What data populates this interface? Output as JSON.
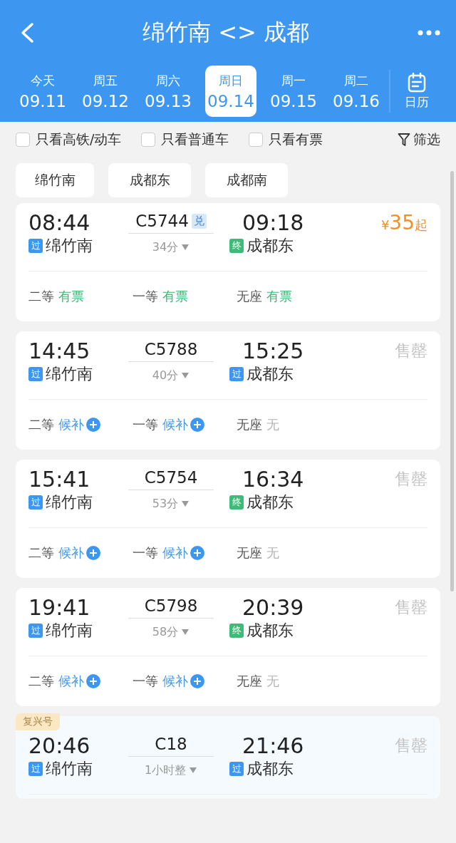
{
  "header": {
    "title": "绵竹南 <> 成都"
  },
  "dates": [
    {
      "weekday": "今天",
      "date": "09.11",
      "selected": false
    },
    {
      "weekday": "周五",
      "date": "09.12",
      "selected": false
    },
    {
      "weekday": "周六",
      "date": "09.13",
      "selected": false
    },
    {
      "weekday": "周日",
      "date": "09.14",
      "selected": true
    },
    {
      "weekday": "周一",
      "date": "09.15",
      "selected": false
    },
    {
      "weekday": "周二",
      "date": "09.16",
      "selected": false
    }
  ],
  "calendar": {
    "label": "日历"
  },
  "filters": [
    {
      "label": "只看高铁/动车",
      "checked": false
    },
    {
      "label": "只看普通车",
      "checked": false
    },
    {
      "label": "只看有票",
      "checked": false
    }
  ],
  "filter_button": {
    "label": "筛选"
  },
  "stations": [
    {
      "label": "绵竹南"
    },
    {
      "label": "成都东"
    },
    {
      "label": "成都南"
    }
  ],
  "trains": [
    {
      "depart": "08:44",
      "train": "C5744",
      "badge": "兑",
      "arrive": "09:18",
      "from_tag": {
        "kind": "pass",
        "text": "过"
      },
      "from": "绵竹南",
      "duration": "34分",
      "to_tag": {
        "kind": "terminal",
        "text": "终"
      },
      "to": "成都东",
      "price": {
        "currency": "¥",
        "amount": "35",
        "suffix": "起"
      },
      "seats": [
        {
          "name": "二等",
          "kind": "available",
          "status": "有票"
        },
        {
          "name": "一等",
          "kind": "available",
          "status": "有票"
        },
        {
          "name": "无座",
          "kind": "available",
          "status": "有票"
        }
      ]
    },
    {
      "depart": "14:45",
      "train": "C5788",
      "arrive": "15:25",
      "from_tag": {
        "kind": "pass",
        "text": "过"
      },
      "from": "绵竹南",
      "duration": "40分",
      "to_tag": {
        "kind": "pass",
        "text": "过"
      },
      "to": "成都东",
      "sold_out": "售罄",
      "seats": [
        {
          "name": "二等",
          "kind": "waitlist",
          "status": "候补"
        },
        {
          "name": "一等",
          "kind": "waitlist",
          "status": "候补"
        },
        {
          "name": "无座",
          "kind": "none",
          "status": "无"
        }
      ]
    },
    {
      "depart": "15:41",
      "train": "C5754",
      "arrive": "16:34",
      "from_tag": {
        "kind": "pass",
        "text": "过"
      },
      "from": "绵竹南",
      "duration": "53分",
      "to_tag": {
        "kind": "terminal",
        "text": "终"
      },
      "to": "成都东",
      "sold_out": "售罄",
      "seats": [
        {
          "name": "二等",
          "kind": "waitlist",
          "status": "候补"
        },
        {
          "name": "一等",
          "kind": "waitlist",
          "status": "候补"
        },
        {
          "name": "无座",
          "kind": "none",
          "status": "无"
        }
      ]
    },
    {
      "depart": "19:41",
      "train": "C5798",
      "arrive": "20:39",
      "from_tag": {
        "kind": "pass",
        "text": "过"
      },
      "from": "绵竹南",
      "duration": "58分",
      "to_tag": {
        "kind": "terminal",
        "text": "终"
      },
      "to": "成都东",
      "sold_out": "售罄",
      "seats": [
        {
          "name": "二等",
          "kind": "waitlist",
          "status": "候补"
        },
        {
          "name": "一等",
          "kind": "waitlist",
          "status": "候补"
        },
        {
          "name": "无座",
          "kind": "none",
          "status": "无"
        }
      ]
    },
    {
      "label": "复兴号",
      "depart": "20:46",
      "train": "C18",
      "arrive": "21:46",
      "from_tag": {
        "kind": "pass",
        "text": "过"
      },
      "from": "绵竹南",
      "duration": "1小时整",
      "to_tag": {
        "kind": "pass",
        "text": "过"
      },
      "to": "成都东",
      "sold_out": "售罄"
    }
  ]
}
